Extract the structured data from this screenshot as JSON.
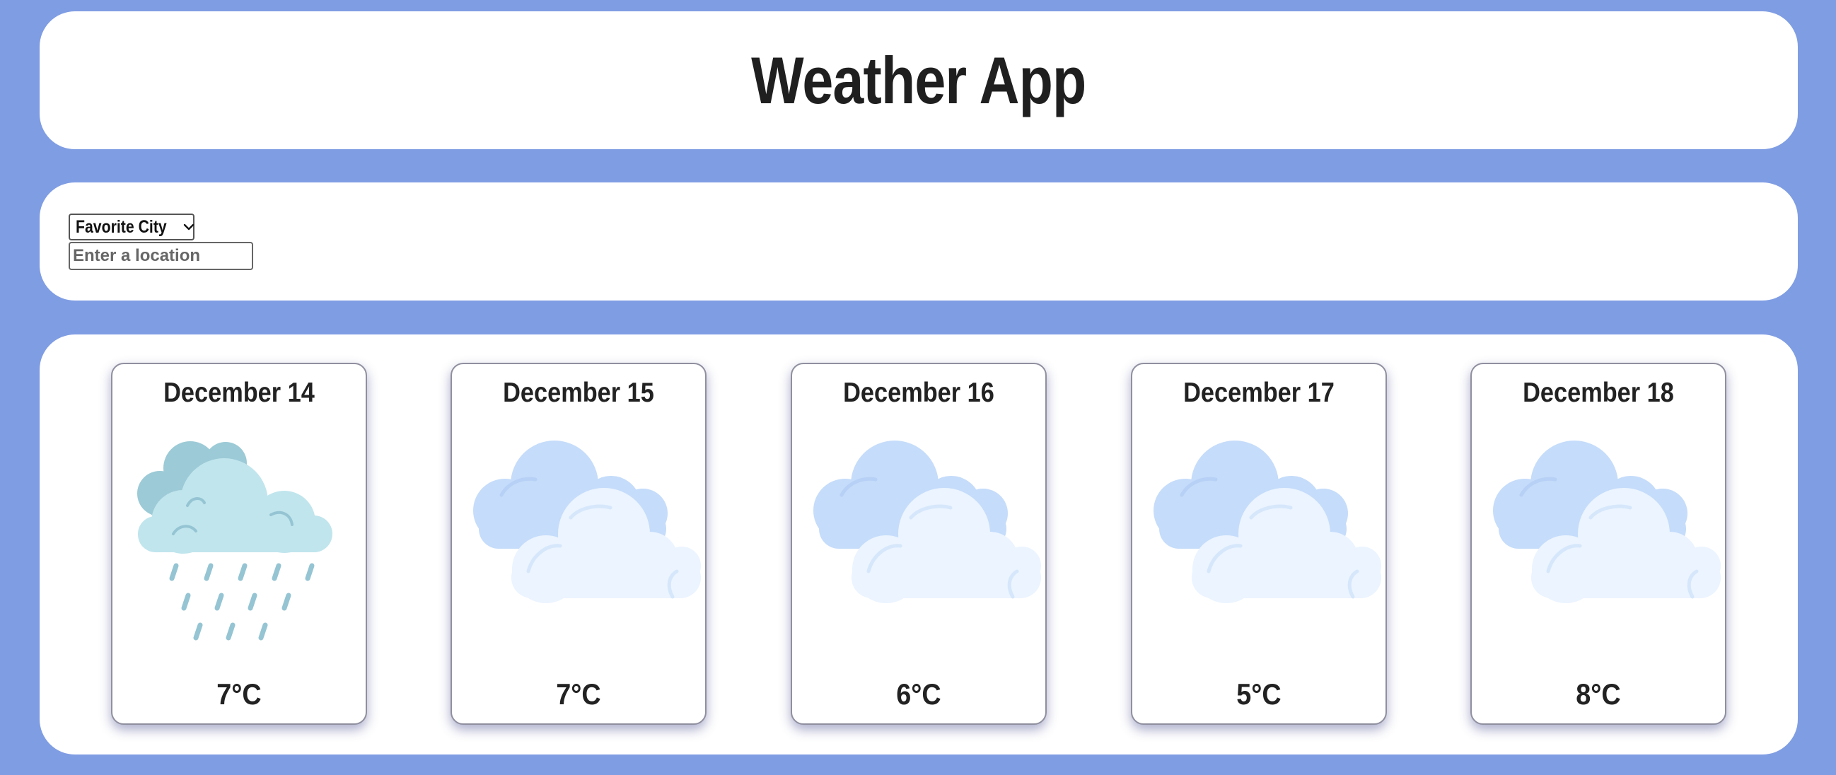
{
  "header": {
    "title": "Weather App"
  },
  "controls": {
    "favorite_city_label": "Favorite City",
    "location_placeholder": "Enter a location",
    "location_value": ""
  },
  "forecast": {
    "days": [
      {
        "date": "December 14",
        "temp": "7°C",
        "icon": "rain-cloud-icon"
      },
      {
        "date": "December 15",
        "temp": "7°C",
        "icon": "cloudy-icon"
      },
      {
        "date": "December 16",
        "temp": "6°C",
        "icon": "cloudy-icon"
      },
      {
        "date": "December 17",
        "temp": "5°C",
        "icon": "cloudy-icon"
      },
      {
        "date": "December 18",
        "temp": "8°C",
        "icon": "cloudy-icon"
      }
    ]
  },
  "colors": {
    "background": "#7f9de3",
    "panel": "#ffffff",
    "card_border": "#8f8f9f",
    "rain_cloud_back": "#9ccad6",
    "rain_cloud_front": "#c0e5ed",
    "rain_drop": "#95c4d3",
    "cloud_back": "#c5dcfa",
    "cloud_front": "#ebf4ff"
  }
}
